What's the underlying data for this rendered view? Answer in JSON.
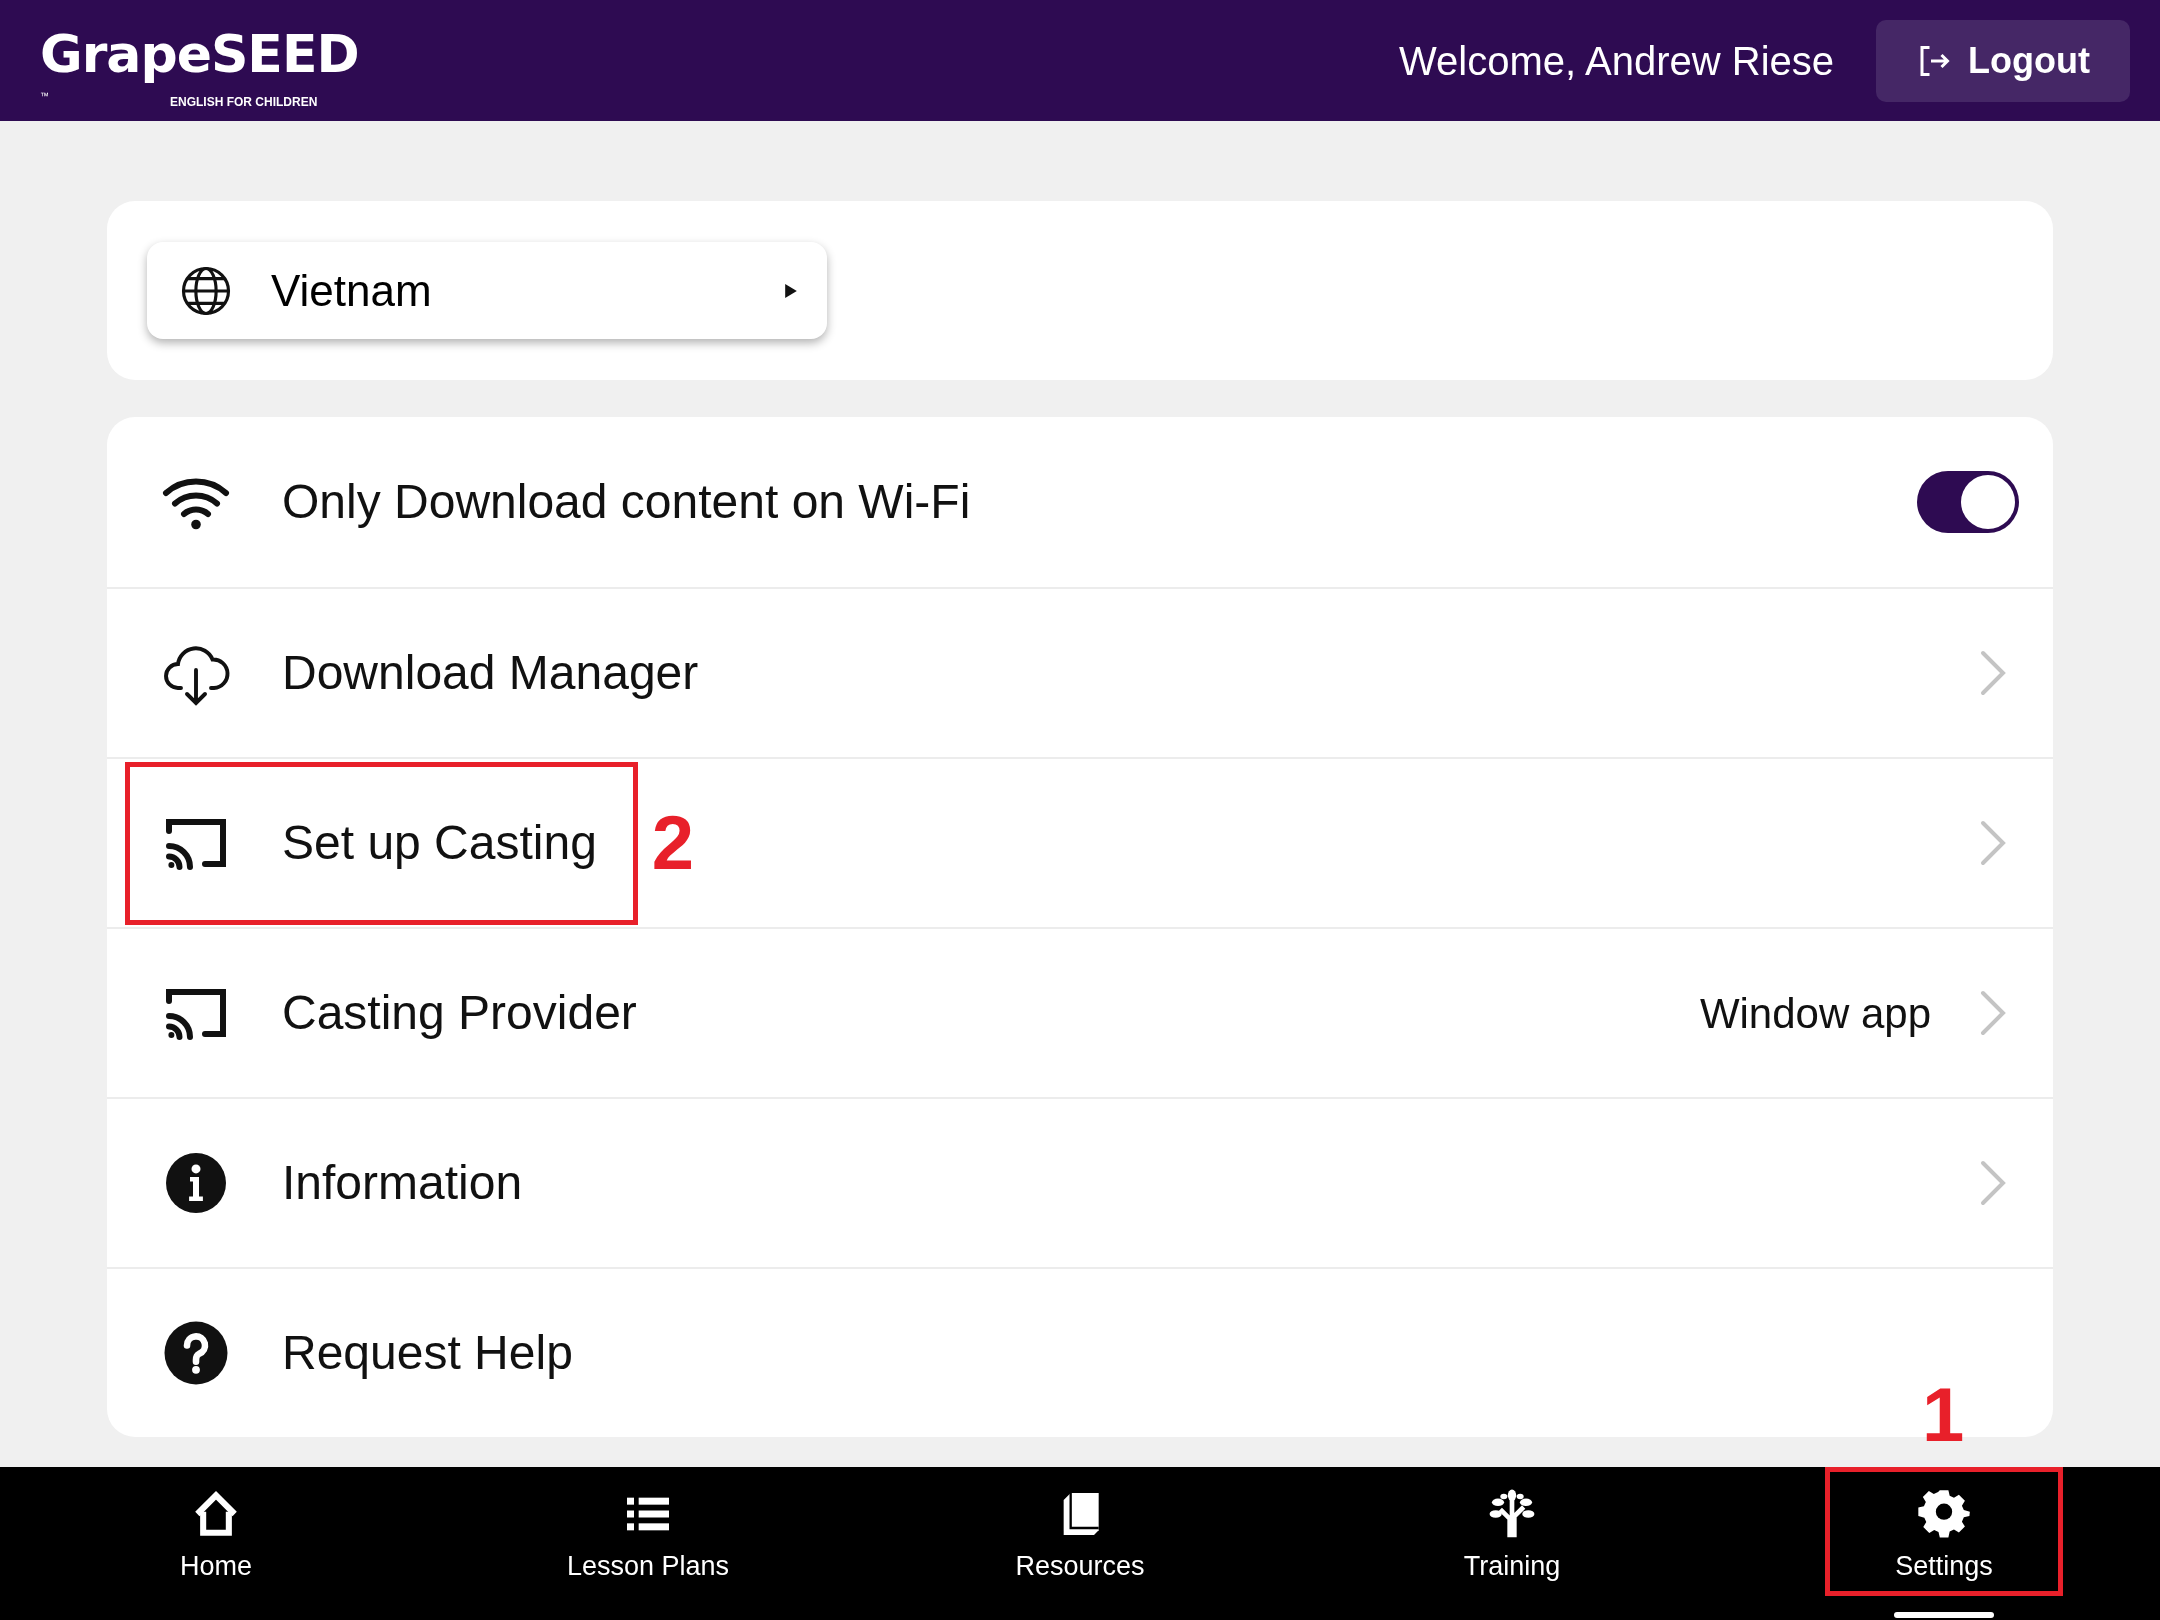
{
  "header": {
    "logo": {
      "wordmark": "GrapeSEED",
      "trademark": "™",
      "tagline": "ENGLISH FOR CHILDREN"
    },
    "welcome": "Welcome, Andrew Riese",
    "logout_button": "Logout"
  },
  "region_selector": {
    "label": "Vietnam"
  },
  "settings": [
    {
      "kind": "toggle",
      "label": "Only Download content on Wi-Fi",
      "on": true
    },
    {
      "kind": "link",
      "label": "Download Manager"
    },
    {
      "kind": "link",
      "label": "Set up Casting",
      "annotation": "2"
    },
    {
      "kind": "link",
      "label": "Casting Provider",
      "value": "Window app"
    },
    {
      "kind": "link",
      "label": "Information"
    },
    {
      "kind": "plain",
      "label": "Request Help"
    }
  ],
  "bottom_nav": [
    {
      "label": "Home",
      "selected": false
    },
    {
      "label": "Lesson Plans",
      "selected": false
    },
    {
      "label": "Resources",
      "selected": false
    },
    {
      "label": "Training",
      "selected": false
    },
    {
      "label": "Settings",
      "selected": true,
      "annotation": "1"
    }
  ]
}
